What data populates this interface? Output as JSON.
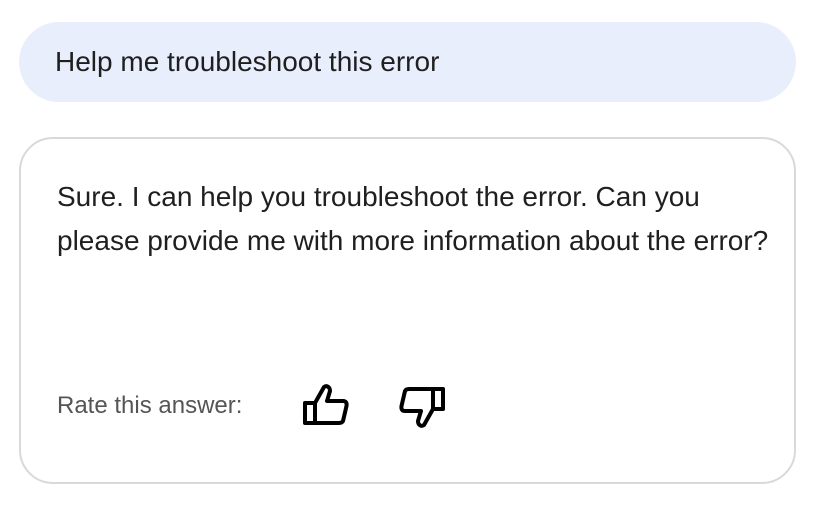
{
  "conversation": {
    "user_message": "Help me troubleshoot this error",
    "assistant_message": "Sure. I can help you troubleshoot the error. Can you please provide me with more information about the error?"
  },
  "feedback": {
    "rate_label": "Rate this answer:",
    "thumbs_up_icon": "thumbs-up-icon",
    "thumbs_down_icon": "thumbs-down-icon"
  },
  "colors": {
    "user_bubble_bg": "#e8eefb",
    "card_border": "#d9d9d9",
    "text": "#1f1f1f",
    "label": "#555555"
  }
}
